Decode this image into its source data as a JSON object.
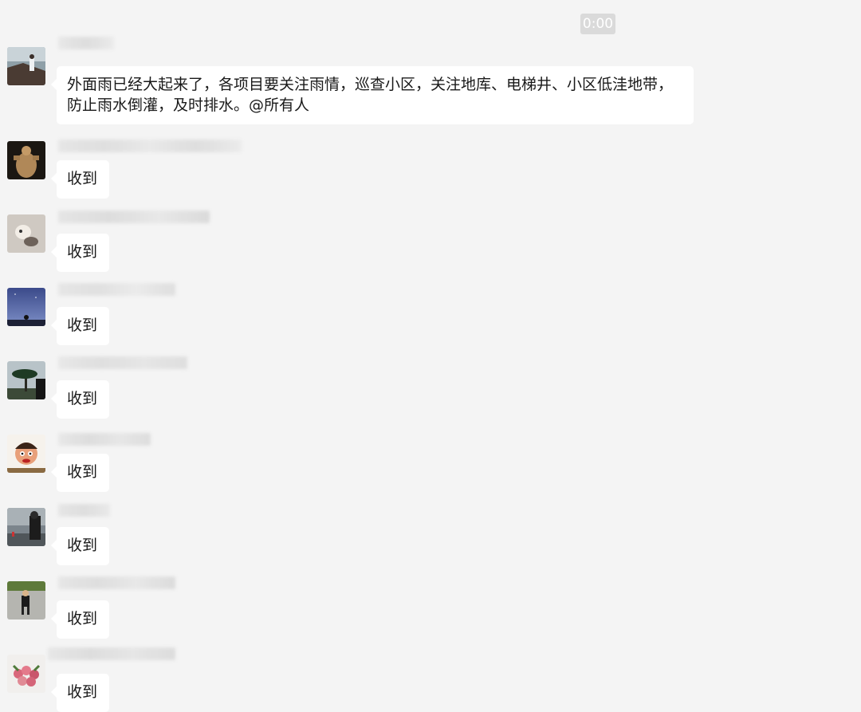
{
  "chat": {
    "timestamp": "0:00",
    "messages": [
      {
        "sender_avatar": "avatar-person-cliff-icon",
        "text": "外面雨已经大起来了，各项目要关注雨情，巡查小区，关注地库、电梯井、小区低洼地带，\n防止雨水倒灌，及时排水。@所有人"
      },
      {
        "sender_avatar": "avatar-figure-dark-icon",
        "text": "收到"
      },
      {
        "sender_avatar": "avatar-toy-icon",
        "text": "收到"
      },
      {
        "sender_avatar": "avatar-night-sky-icon",
        "text": "收到"
      },
      {
        "sender_avatar": "avatar-tree-landscape-icon",
        "text": "收到"
      },
      {
        "sender_avatar": "avatar-cartoon-icon",
        "text": "收到"
      },
      {
        "sender_avatar": "avatar-person-shore-icon",
        "text": "收到"
      },
      {
        "sender_avatar": "avatar-child-icon",
        "text": "收到"
      },
      {
        "sender_avatar": "avatar-flowers-icon",
        "text": "收到"
      }
    ]
  },
  "colors": {
    "background": "#f4f4f4",
    "bubble": "#ffffff",
    "timestamp_bg": "#dadada"
  }
}
